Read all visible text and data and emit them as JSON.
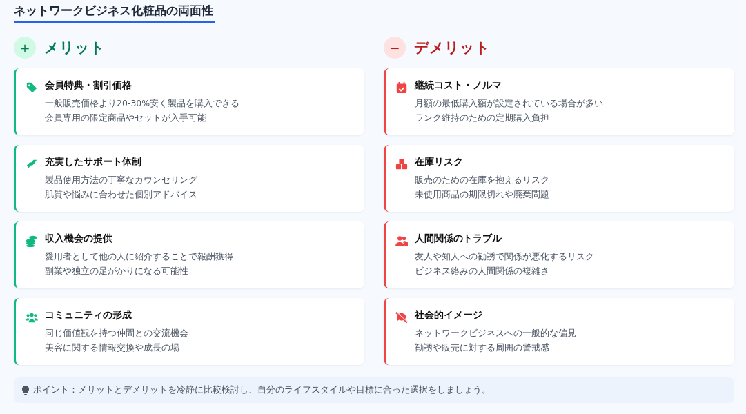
{
  "title": "ネットワークビジネス化粧品の両面性",
  "columns": [
    {
      "kind": "merit",
      "sign": "+",
      "heading": "メリット",
      "cards": [
        {
          "title": "会員特典・割引価格",
          "lines": [
            "一般販売価格より20-30%安く製品を購入できる",
            "会員専用の限定商品やセットが入手可能"
          ]
        },
        {
          "title": "充実したサポート体制",
          "lines": [
            "製品使用方法の丁寧なカウンセリング",
            "肌質や悩みに合わせた個別アドバイス"
          ]
        },
        {
          "title": "収入機会の提供",
          "lines": [
            "愛用者として他の人に紹介することで報酬獲得",
            "副業や独立の足がかりになる可能性"
          ]
        },
        {
          "title": "コミュニティの形成",
          "lines": [
            "同じ価値観を持つ仲間との交流機会",
            "美容に関する情報交換や成長の場"
          ]
        }
      ]
    },
    {
      "kind": "demerit",
      "sign": "−",
      "heading": "デメリット",
      "cards": [
        {
          "title": "継続コスト・ノルマ",
          "lines": [
            "月額の最低購入額が設定されている場合が多い",
            "ランク維持のための定期購入負担"
          ]
        },
        {
          "title": "在庫リスク",
          "lines": [
            "販売のための在庫を抱えるリスク",
            "未使用商品の期限切れや廃棄問題"
          ]
        },
        {
          "title": "人間関係のトラブル",
          "lines": [
            "友人や知人への勧誘で関係が悪化するリスク",
            "ビジネス絡みの人間関係の複雑さ"
          ]
        },
        {
          "title": "社会的イメージ",
          "lines": [
            "ネットワークビジネスへの一般的な偏見",
            "勧誘や販売に対する周囲の警戒感"
          ]
        }
      ]
    }
  ],
  "tip": "ポイント：メリットとデメリットを冷静に比較検討し、自分のライフスタイルや目標に合った選択をしましょう。"
}
